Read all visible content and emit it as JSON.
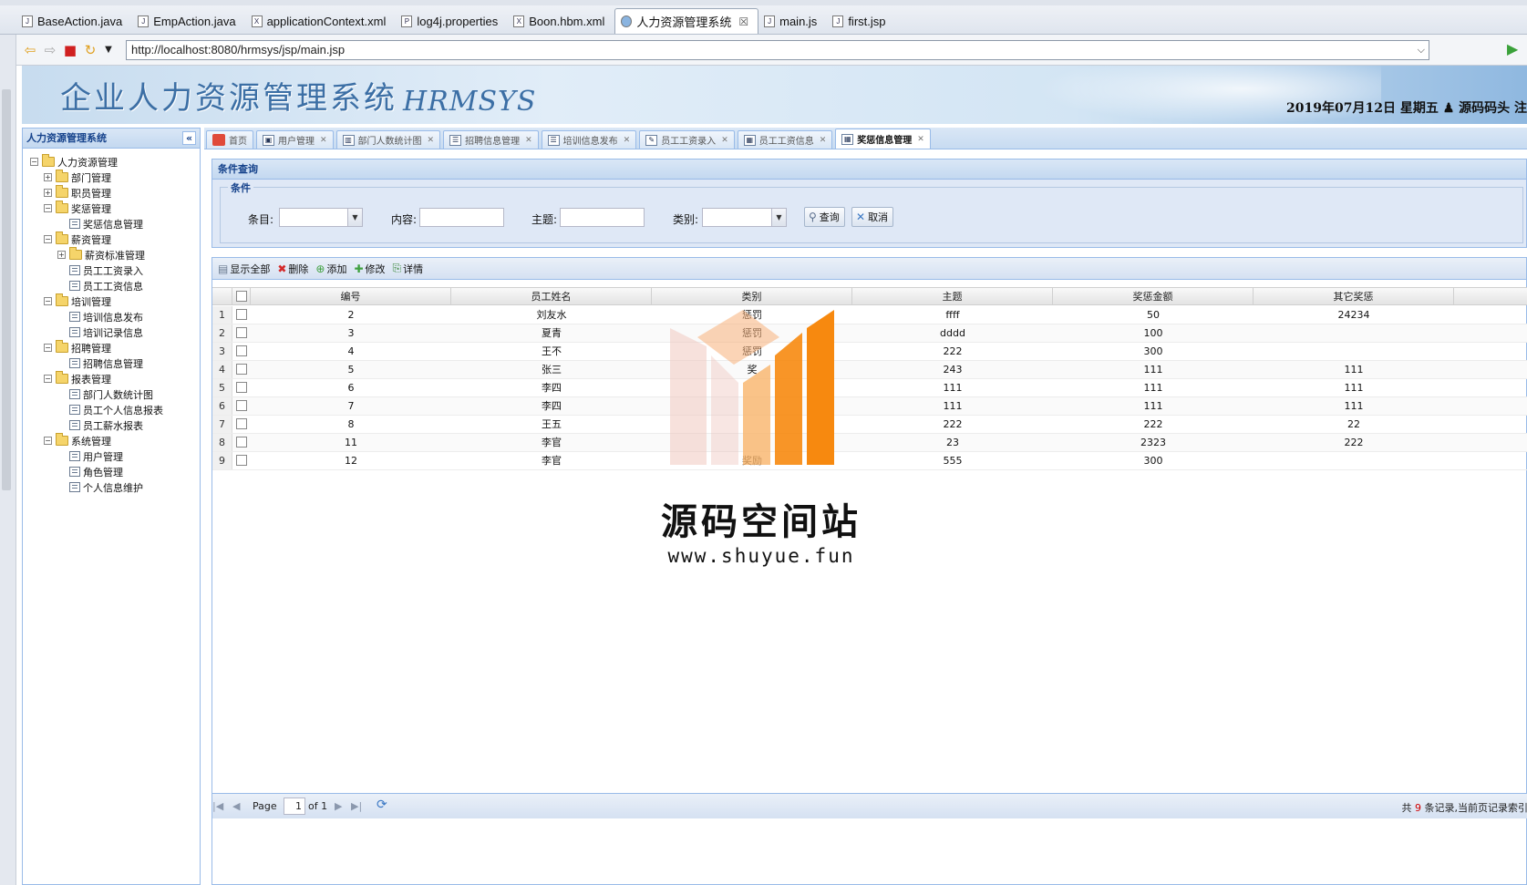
{
  "editor_tabs": [
    {
      "label": "BaseAction.java",
      "icon": "J",
      "active": false
    },
    {
      "label": "EmpAction.java",
      "icon": "J",
      "active": false
    },
    {
      "label": "applicationContext.xml",
      "icon": "X",
      "active": false
    },
    {
      "label": "log4j.properties",
      "icon": "P",
      "active": false
    },
    {
      "label": "Boon.hbm.xml",
      "icon": "X",
      "active": false
    },
    {
      "label": "人力资源管理系统",
      "icon": "globe",
      "active": true,
      "close": "☒"
    },
    {
      "label": "main.js",
      "icon": "js",
      "active": false
    },
    {
      "label": "first.jsp",
      "icon": "jsp",
      "active": false
    }
  ],
  "browser": {
    "url": "http://localhost:8080/hrmsys/jsp/main.jsp"
  },
  "banner": {
    "title": "企业人力资源管理系统",
    "subtitle": "HRMSYS",
    "date_user": "2019年07月12日 星期五 ♟ 源码码头  注"
  },
  "sidebar": {
    "title": "人力资源管理系统",
    "collapse": "«",
    "tree": [
      {
        "label": "人力资源管理",
        "depth": 0,
        "type": "folder",
        "toggle": "−"
      },
      {
        "label": "部门管理",
        "depth": 1,
        "type": "folder",
        "toggle": "+"
      },
      {
        "label": "职员管理",
        "depth": 1,
        "type": "folder",
        "toggle": "+"
      },
      {
        "label": "奖惩管理",
        "depth": 1,
        "type": "folder",
        "toggle": "−"
      },
      {
        "label": "奖惩信息管理",
        "depth": 2,
        "type": "leaf"
      },
      {
        "label": "薪资管理",
        "depth": 1,
        "type": "folder",
        "toggle": "−"
      },
      {
        "label": "薪资标准管理",
        "depth": 2,
        "type": "folder",
        "toggle": "+"
      },
      {
        "label": "员工工资录入",
        "depth": 2,
        "type": "leaf"
      },
      {
        "label": "员工工资信息",
        "depth": 2,
        "type": "leaf"
      },
      {
        "label": "培训管理",
        "depth": 1,
        "type": "folder",
        "toggle": "−"
      },
      {
        "label": "培训信息发布",
        "depth": 2,
        "type": "leaf"
      },
      {
        "label": "培训记录信息",
        "depth": 2,
        "type": "leaf"
      },
      {
        "label": "招聘管理",
        "depth": 1,
        "type": "folder",
        "toggle": "−"
      },
      {
        "label": "招聘信息管理",
        "depth": 2,
        "type": "leaf"
      },
      {
        "label": "报表管理",
        "depth": 1,
        "type": "folder",
        "toggle": "−"
      },
      {
        "label": "部门人数统计图",
        "depth": 2,
        "type": "leaf"
      },
      {
        "label": "员工个人信息报表",
        "depth": 2,
        "type": "leaf"
      },
      {
        "label": "员工薪水报表",
        "depth": 2,
        "type": "leaf"
      },
      {
        "label": "系统管理",
        "depth": 1,
        "type": "folder",
        "toggle": "−"
      },
      {
        "label": "用户管理",
        "depth": 2,
        "type": "leaf"
      },
      {
        "label": "角色管理",
        "depth": 2,
        "type": "leaf"
      },
      {
        "label": "个人信息维护",
        "depth": 2,
        "type": "leaf"
      }
    ]
  },
  "main_tabs": [
    {
      "label": "首页",
      "icon": "home",
      "closable": false,
      "active": false
    },
    {
      "label": "用户管理",
      "icon": "user",
      "closable": true,
      "active": false
    },
    {
      "label": "部门人数统计图",
      "icon": "chart",
      "closable": true,
      "active": false
    },
    {
      "label": "招聘信息管理",
      "icon": "list",
      "closable": true,
      "active": false
    },
    {
      "label": "培训信息发布",
      "icon": "list",
      "closable": true,
      "active": false
    },
    {
      "label": "员工工资录入",
      "icon": "edit",
      "closable": true,
      "active": false
    },
    {
      "label": "员工工资信息",
      "icon": "table",
      "closable": true,
      "active": false
    },
    {
      "label": "奖惩信息管理",
      "icon": "table",
      "closable": true,
      "active": true
    }
  ],
  "query": {
    "panel_title": "条件查询",
    "legend": "条件",
    "fields": [
      {
        "label": "条目:",
        "type": "combo",
        "value": ""
      },
      {
        "label": "内容:",
        "type": "text",
        "value": ""
      },
      {
        "label": "主题:",
        "type": "text",
        "value": ""
      },
      {
        "label": "类别:",
        "type": "combo",
        "value": ""
      }
    ],
    "search_label": "查询",
    "cancel_label": "取消"
  },
  "toolbar": {
    "show_all": "显示全部",
    "delete": "删除",
    "add": "添加",
    "edit": "修改",
    "detail": "详情"
  },
  "grid": {
    "columns": [
      "编号",
      "员工姓名",
      "类别",
      "主题",
      "奖惩金额",
      "其它奖惩"
    ],
    "rows": [
      {
        "n": "1",
        "id": "2",
        "name": "刘友水",
        "type": "惩罚",
        "topic": "ffff",
        "amount": "50",
        "other": "24234"
      },
      {
        "n": "2",
        "id": "3",
        "name": "夏青",
        "type": "惩罚",
        "topic": "dddd",
        "amount": "100",
        "other": ""
      },
      {
        "n": "3",
        "id": "4",
        "name": "王不",
        "type": "惩罚",
        "topic": "222",
        "amount": "300",
        "other": ""
      },
      {
        "n": "4",
        "id": "5",
        "name": "张三",
        "type": "奖",
        "topic": "243",
        "amount": "111",
        "other": "111"
      },
      {
        "n": "5",
        "id": "6",
        "name": "李四",
        "type": "",
        "topic": "111",
        "amount": "111",
        "other": "111"
      },
      {
        "n": "6",
        "id": "7",
        "name": "李四",
        "type": "",
        "topic": "111",
        "amount": "111",
        "other": "111"
      },
      {
        "n": "7",
        "id": "8",
        "name": "王五",
        "type": "",
        "topic": "222",
        "amount": "222",
        "other": "22"
      },
      {
        "n": "8",
        "id": "11",
        "name": "李官",
        "type": "",
        "topic": "23",
        "amount": "2323",
        "other": "222"
      },
      {
        "n": "9",
        "id": "12",
        "name": "李官",
        "type": "奖励",
        "topic": "555",
        "amount": "300",
        "other": ""
      }
    ]
  },
  "pager": {
    "page_label": "Page",
    "page_value": "1",
    "of_label": "of 1",
    "summary_prefix": "共",
    "summary_count": "9",
    "summary_suffix": "条记录,当前页记录索引"
  },
  "watermark": {
    "text": "源码空间站",
    "url": "www.shuyue.fun"
  },
  "colors": {
    "panel_border": "#99bbe8",
    "panel_title": "#15428b",
    "watermark_orange": "#f7890f",
    "watermark_pink": "#f0c8c0",
    "count_red": "#d00000"
  }
}
